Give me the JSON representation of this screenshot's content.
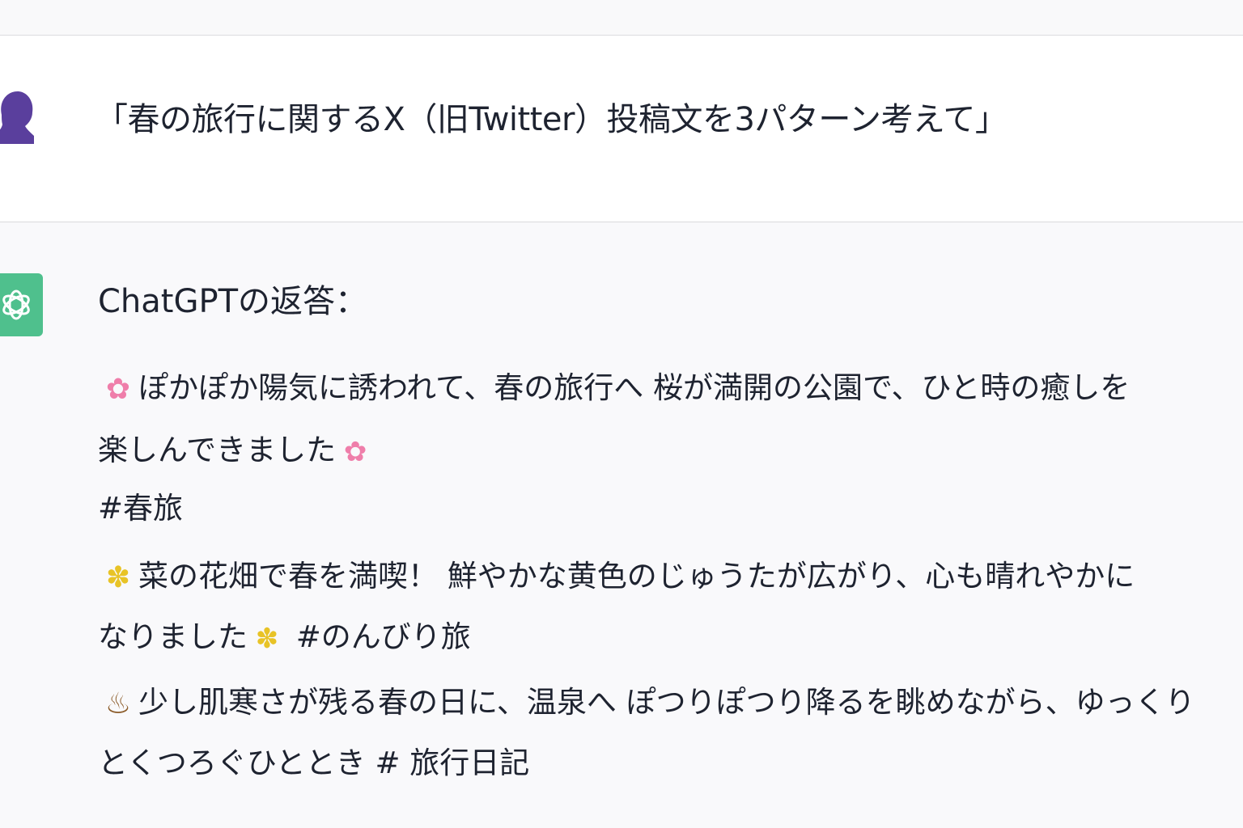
{
  "conversation": {
    "user_message": "「春の旅行に関するX（旧Twitter）投稿文を3パターン考えて」",
    "assistant_title": "ChatGPTの返答：",
    "responses": [
      {
        "line1_icon": "cherry-blossom",
        "line1_text": "ぽかぽか陽気に誘われて、春の旅行へ  桜が満開の公園で、ひと時の癒しを",
        "line2_text": "楽しんできました",
        "line2_icon": "cherry-blossom",
        "line3_text": "#春旅"
      },
      {
        "line1_icon": "yellow-flower",
        "line1_text": "菜の花畑で春を満喫！ 鮮やかな黄色のじゅうたが広がり、心も晴れやかに",
        "line2_text": "なりました",
        "line2_icon": "yellow-flower",
        "line2_suffix": " #のんびり旅"
      },
      {
        "line1_icon": "hot-spring",
        "line1_text": "少し肌寒さが残る春の日に、温泉へ  ぽつりぽつり降るを眺めながら、ゆっくり",
        "line2_text": "とくつろぐひととき # 旅行日記"
      }
    ]
  },
  "colors": {
    "user_avatar": "#5a3f9d",
    "assistant_avatar": "#4fc08d",
    "text": "#1e2330"
  }
}
